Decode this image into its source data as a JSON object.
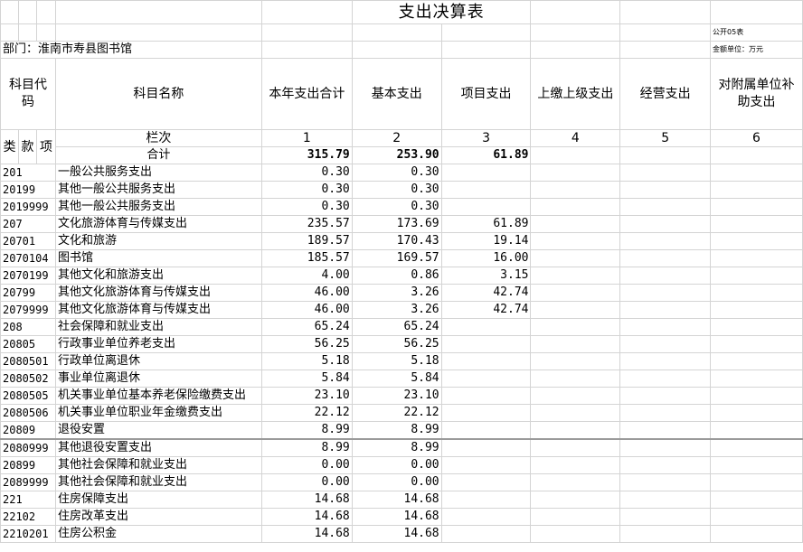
{
  "title": "支出决算表",
  "form_code": "公开05表",
  "department": "部门：淮南市寿县图书馆",
  "unit": "金额单位：万元",
  "headers": {
    "code": "科目代码",
    "name": "科目名称",
    "total": "本年支出合计",
    "basic": "基本支出",
    "project": "项目支出",
    "upper": "上缴上级支出",
    "business": "经营支出",
    "subsidy": "对附属单位补助支出",
    "lei": "类",
    "kuan": "款",
    "xiang": "项",
    "lanci": "栏次",
    "heji": "合计"
  },
  "column_numbers": [
    "1",
    "2",
    "3",
    "4",
    "5",
    "6"
  ],
  "totals": {
    "total": "315.79",
    "basic": "253.90",
    "project": "61.89"
  },
  "rows": [
    {
      "code": "201",
      "name": "一般公共服务支出",
      "total": "0.30",
      "basic": "0.30",
      "project": ""
    },
    {
      "code": "20199",
      "name": "其他一般公共服务支出",
      "total": "0.30",
      "basic": "0.30",
      "project": ""
    },
    {
      "code": "2019999",
      "name": "其他一般公共服务支出",
      "total": "0.30",
      "basic": "0.30",
      "project": ""
    },
    {
      "code": "207",
      "name": "文化旅游体育与传媒支出",
      "total": "235.57",
      "basic": "173.69",
      "project": "61.89"
    },
    {
      "code": "20701",
      "name": "文化和旅游",
      "total": "189.57",
      "basic": "170.43",
      "project": "19.14"
    },
    {
      "code": "2070104",
      "name": "图书馆",
      "total": "185.57",
      "basic": "169.57",
      "project": "16.00"
    },
    {
      "code": "2070199",
      "name": "其他文化和旅游支出",
      "total": "4.00",
      "basic": "0.86",
      "project": "3.15"
    },
    {
      "code": "20799",
      "name": "其他文化旅游体育与传媒支出",
      "total": "46.00",
      "basic": "3.26",
      "project": "42.74"
    },
    {
      "code": "2079999",
      "name": "其他文化旅游体育与传媒支出",
      "total": "46.00",
      "basic": "3.26",
      "project": "42.74"
    },
    {
      "code": "208",
      "name": "社会保障和就业支出",
      "total": "65.24",
      "basic": "65.24",
      "project": ""
    },
    {
      "code": "20805",
      "name": "行政事业单位养老支出",
      "total": "56.25",
      "basic": "56.25",
      "project": ""
    },
    {
      "code": "2080501",
      "name": "行政单位离退休",
      "total": "5.18",
      "basic": "5.18",
      "project": ""
    },
    {
      "code": "2080502",
      "name": "事业单位离退休",
      "total": "5.84",
      "basic": "5.84",
      "project": ""
    },
    {
      "code": "2080505",
      "name": "机关事业单位基本养老保险缴费支出",
      "total": "23.10",
      "basic": "23.10",
      "project": ""
    },
    {
      "code": "2080506",
      "name": "机关事业单位职业年金缴费支出",
      "total": "22.12",
      "basic": "22.12",
      "project": ""
    },
    {
      "code": "20809",
      "name": "退役安置",
      "total": "8.99",
      "basic": "8.99",
      "project": ""
    },
    {
      "code": "2080999",
      "name": "其他退役安置支出",
      "total": "8.99",
      "basic": "8.99",
      "project": ""
    },
    {
      "code": "20899",
      "name": "其他社会保障和就业支出",
      "total": "0.00",
      "basic": "0.00",
      "project": ""
    },
    {
      "code": "2089999",
      "name": "其他社会保障和就业支出",
      "total": "0.00",
      "basic": "0.00",
      "project": ""
    },
    {
      "code": "221",
      "name": "住房保障支出",
      "total": "14.68",
      "basic": "14.68",
      "project": ""
    },
    {
      "code": "22102",
      "name": "住房改革支出",
      "total": "14.68",
      "basic": "14.68",
      "project": ""
    },
    {
      "code": "2210201",
      "name": "住房公积金",
      "total": "14.68",
      "basic": "14.68",
      "project": ""
    }
  ]
}
